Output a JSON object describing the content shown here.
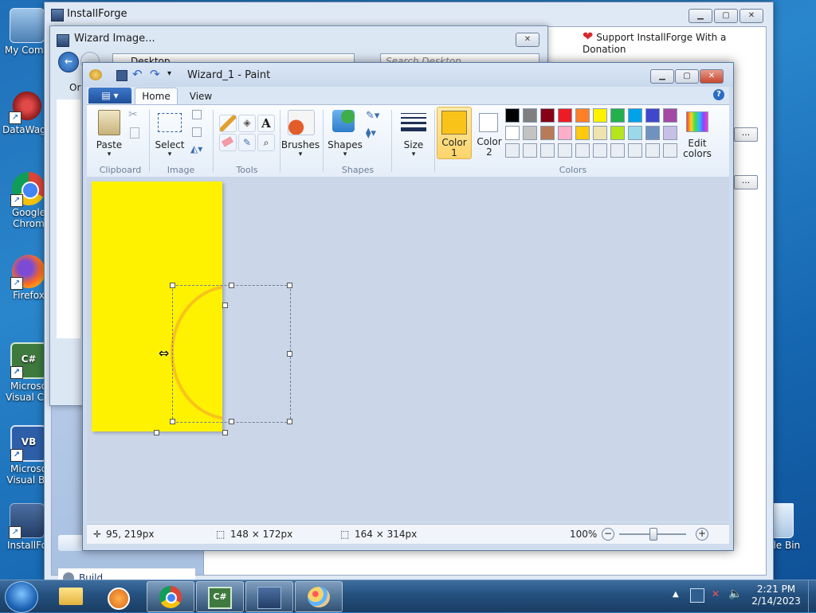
{
  "desktop": {
    "icons": [
      {
        "label1": "My Comp",
        "label2": ""
      },
      {
        "label1": "DataWago",
        "label2": ""
      },
      {
        "label1": "Google",
        "label2": "Chrom"
      },
      {
        "label1": "Firefox",
        "label2": ""
      },
      {
        "label1": "Microso",
        "label2": "Visual C#"
      },
      {
        "label1": "Microso",
        "label2": "Visual Ba"
      },
      {
        "label1": "InstallFo",
        "label2": ""
      },
      {
        "label1": "cle Bin",
        "label2": ""
      }
    ]
  },
  "installforge": {
    "title": "InstallForge",
    "donation": "Support InstallForge With a Donation",
    "sidebar_item": "Build",
    "sidebar_header": "Build",
    "browse_label": "..."
  },
  "wizard_dialog": {
    "title": "Wizard Image...",
    "location": "Desktop",
    "search_placeholder": "Search Desktop",
    "menu_partial": "Or"
  },
  "paint": {
    "title": "Wizard_1 - Paint",
    "tabs": {
      "home": "Home",
      "view": "View"
    },
    "groups": {
      "clipboard": "Clipboard",
      "image": "Image",
      "tools": "Tools",
      "shapes": "Shapes",
      "colors": "Colors"
    },
    "buttons": {
      "paste": "Paste",
      "select": "Select",
      "brushes": "Brushes",
      "shapes": "Shapes",
      "size": "Size",
      "color1_a": "Color",
      "color1_b": "1",
      "color2_a": "Color",
      "color2_b": "2",
      "edit_a": "Edit",
      "edit_b": "colors"
    },
    "colors": {
      "color1": "#f9c31a",
      "color2": "#ffffff",
      "row1": [
        "#000000",
        "#7f7f7f",
        "#880015",
        "#ed1c24",
        "#ff7f27",
        "#fff200",
        "#22b14c",
        "#00a2e8",
        "#3f48cc",
        "#a349a4"
      ],
      "row2": [
        "#ffffff",
        "#c3c3c3",
        "#b97a57",
        "#ffaec9",
        "#ffc90e",
        "#efe4b0",
        "#b5e61d",
        "#99d9ea",
        "#7092be",
        "#c8bfe7"
      ]
    },
    "status": {
      "cursor": "95, 219px",
      "selection": "148 × 172px",
      "image_size": "164 × 314px",
      "zoom": "100%"
    }
  },
  "taskbar": {
    "time": "2:21 PM",
    "date": "2/14/2023"
  }
}
